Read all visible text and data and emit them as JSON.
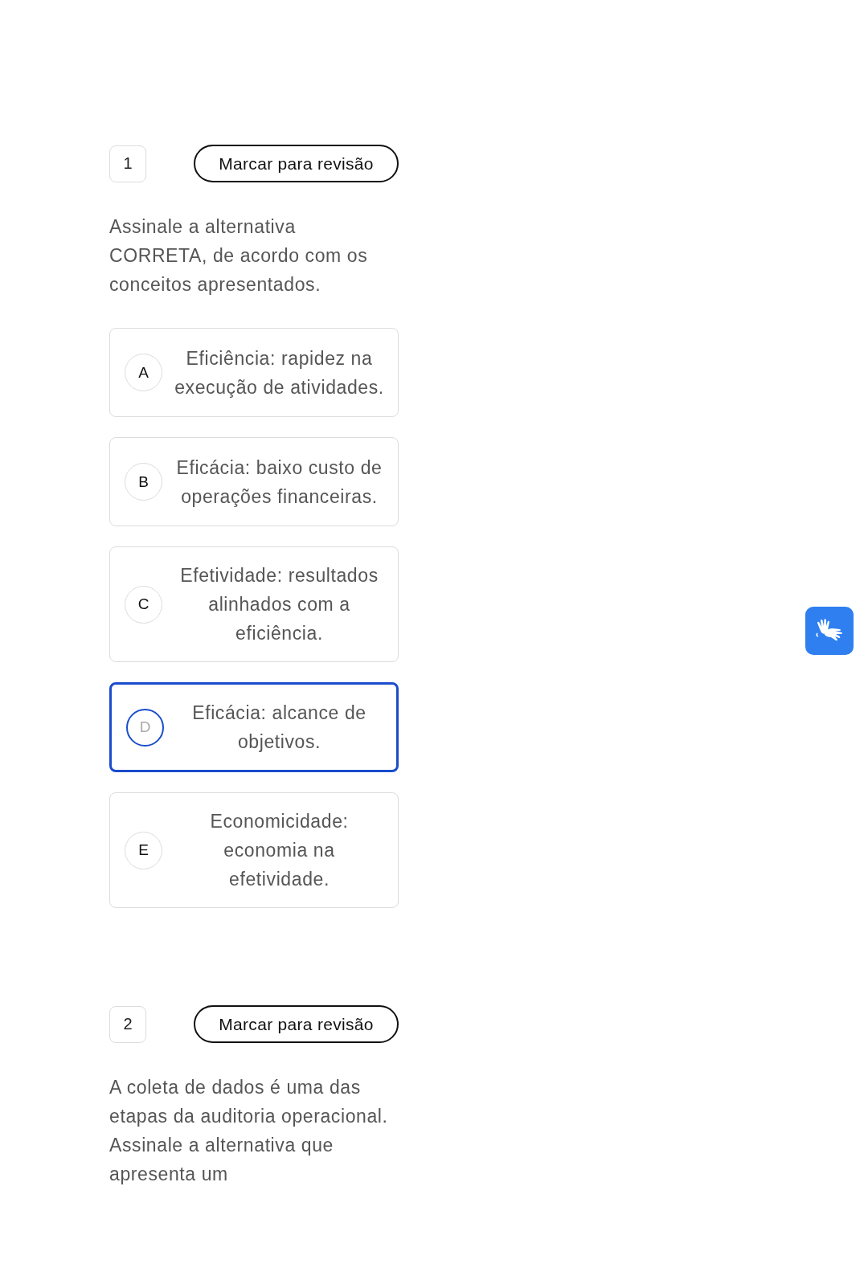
{
  "questions": [
    {
      "number": "1",
      "review_button": "Marcar para revisão",
      "text": "Assinale a alternativa CORRETA, de acordo com os conceitos apresentados.",
      "options": [
        {
          "letter": "A",
          "text": "Eficiência: rapidez na execução de atividades.",
          "selected": false
        },
        {
          "letter": "B",
          "text": "Eficácia: baixo custo de operações financeiras.",
          "selected": false
        },
        {
          "letter": "C",
          "text": "Efetividade: resultados alinhados com a eficiência.",
          "selected": false
        },
        {
          "letter": "D",
          "text": "Eficácia: alcance de objetivos.",
          "selected": true
        },
        {
          "letter": "E",
          "text": "Economicidade: economia na efetividade.",
          "selected": false
        }
      ]
    },
    {
      "number": "2",
      "review_button": "Marcar para revisão",
      "text": "A coleta de dados é uma das etapas da auditoria operacional. Assinale a alternativa que apresenta um"
    }
  ]
}
